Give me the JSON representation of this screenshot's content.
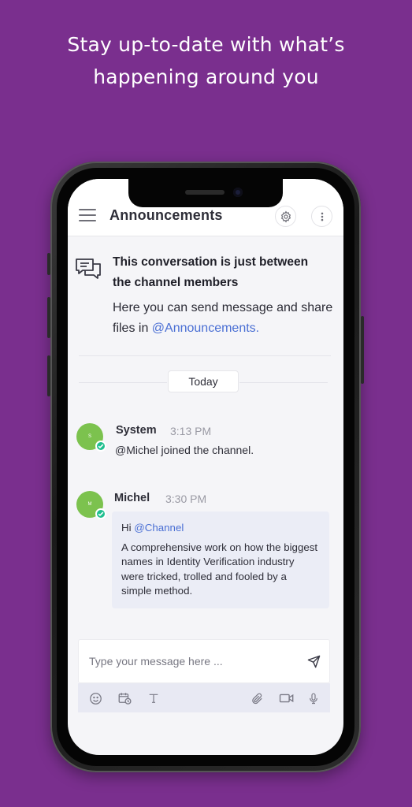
{
  "promo": {
    "line1": "Stay up-to-date with what’s",
    "line2": "happening around you"
  },
  "colors": {
    "background": "#7a2f8e",
    "accent": "#4a6fd4",
    "avatar": "#7cc24e",
    "verified": "#1fbf8f"
  },
  "header": {
    "title": "Announcements",
    "icons": [
      "menu-icon",
      "gear-icon",
      "more-vertical-icon"
    ]
  },
  "intro": {
    "title": "This conversation is just between the channel members",
    "body_prefix": "Here you can send message and share files in ",
    "channel_mention": "@Announcements."
  },
  "divider": {
    "label": "Today"
  },
  "messages": [
    {
      "sender": "System",
      "time": "3:13 PM",
      "avatar_initial": "S",
      "text": "@Michel joined the channel."
    },
    {
      "sender": "Michel",
      "time": "3:30 PM",
      "avatar_initial": "M",
      "greeting": "Hi ",
      "mention": "@Channel",
      "text": "A comprehensive work on how the biggest names in Identity Verification industry were tricked, trolled and fooled by a simple method."
    }
  ],
  "composer": {
    "placeholder": "Type your message here ...",
    "tools": [
      "emoji-icon",
      "schedule-icon",
      "text-format-icon",
      "attach-icon",
      "video-icon",
      "mic-icon"
    ]
  }
}
